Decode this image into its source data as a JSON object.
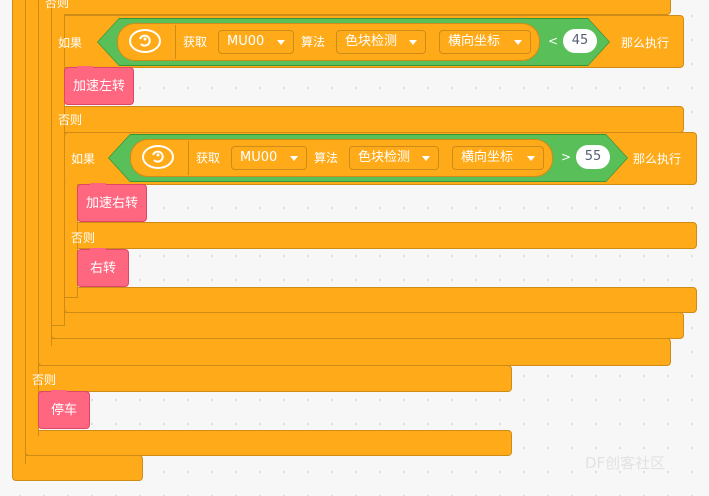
{
  "blocks": {
    "else_label": "否则",
    "if_label": "如果",
    "then_label": "那么执行",
    "get_label": "获取",
    "algo_label": "算法",
    "condition_1": {
      "sensor": "MU00",
      "algorithm": "色块检测",
      "field": "横向坐标",
      "operator": "<",
      "value": "45"
    },
    "condition_2": {
      "sensor": "MU00",
      "algorithm": "色块检测",
      "field": "横向坐标",
      "operator": ">",
      "value": "55"
    },
    "action_1": "加速左转",
    "action_2": "加速右转",
    "action_3": "右转",
    "action_4": "停车"
  },
  "icons": {
    "sensor_icon": "mu-vision-sensor-icon"
  },
  "watermark": "DF创客社区",
  "colors": {
    "control": "#ffab19",
    "control_border": "#cf8b17",
    "operator": "#59c059",
    "action": "#ff6680",
    "background": "#f7f7f7"
  }
}
